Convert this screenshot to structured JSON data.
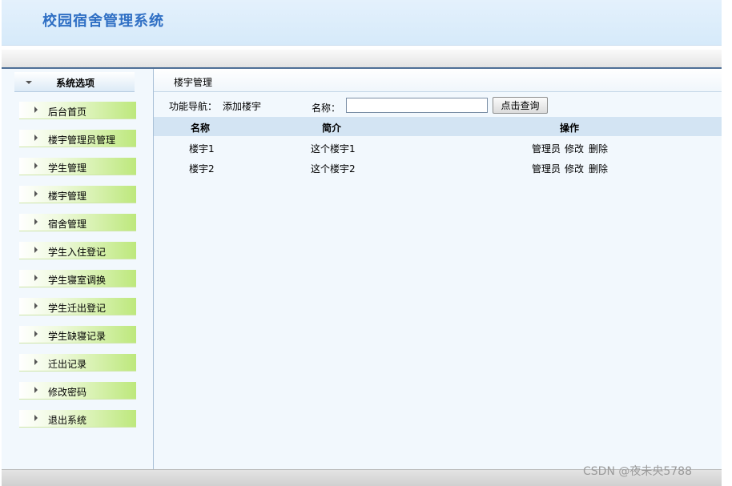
{
  "header": {
    "title": "校园宿舍管理系统"
  },
  "sidebar": {
    "title": "系统选项",
    "items": [
      {
        "label": "后台首页"
      },
      {
        "label": "楼宇管理员管理"
      },
      {
        "label": "学生管理"
      },
      {
        "label": "楼宇管理"
      },
      {
        "label": "宿舍管理"
      },
      {
        "label": "学生入住登记"
      },
      {
        "label": "学生寝室调换"
      },
      {
        "label": "学生迁出登记"
      },
      {
        "label": "学生缺寝记录"
      },
      {
        "label": "迁出记录"
      },
      {
        "label": "修改密码"
      },
      {
        "label": "退出系统"
      }
    ]
  },
  "main": {
    "breadcrumb": "楼宇管理",
    "nav_label": "功能导航：",
    "nav_link": "添加楼宇",
    "search": {
      "label": "名称：",
      "value": "",
      "button": "点击查询"
    },
    "table": {
      "columns": [
        "名称",
        "简介",
        "操作"
      ],
      "rows": [
        {
          "name": "楼宇1",
          "desc": "这个楼宇1",
          "ops": [
            "管理员",
            "修改",
            "删除"
          ]
        },
        {
          "name": "楼宇2",
          "desc": "这个楼宇2",
          "ops": [
            "管理员",
            "修改",
            "删除"
          ]
        }
      ]
    }
  },
  "watermark": "CSDN @夜未央5788"
}
